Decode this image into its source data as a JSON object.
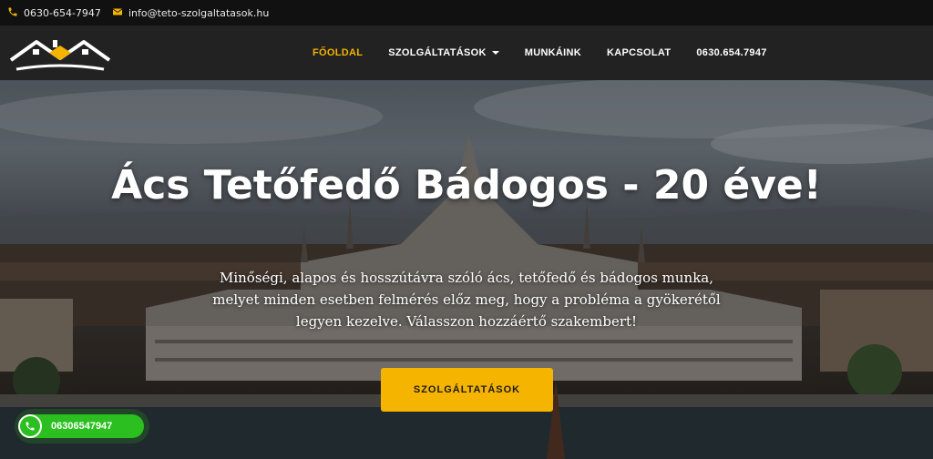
{
  "topbar": {
    "phone": "0630-654-7947",
    "email": "info@teto-szolgaltatasok.hu"
  },
  "nav": {
    "items": [
      {
        "label": "FŐOLDAL",
        "active": true
      },
      {
        "label": "SZOLGÁLTATÁSOK",
        "dropdown": true
      },
      {
        "label": "MUNKÁINK"
      },
      {
        "label": "KAPCSOLAT"
      },
      {
        "label": "0630.654.7947"
      }
    ]
  },
  "hero": {
    "title": "Ács Tetőfedő Bádogos - 20 éve!",
    "subtitle": "Minőségi, alapos és hosszútávra szóló ács, tetőfedő és bádogos munka, melyet minden esetben felmérés előz meg, hogy a probléma a gyökerétől legyen kezelve. Válasszon hozzáértő szakembert!",
    "cta_label": "SZOLGÁLTATÁSOK"
  },
  "floating_phone": {
    "number": "06306547947"
  },
  "colors": {
    "accent": "#f5b400",
    "phone_green": "#2bbf1f",
    "nav_bg": "#222222",
    "topbar_bg": "#111111"
  },
  "icons": {
    "topbar_phone": "phone-icon",
    "topbar_email": "envelope-icon",
    "logo": "house-roofs-logo",
    "floating_phone": "phone-icon"
  }
}
